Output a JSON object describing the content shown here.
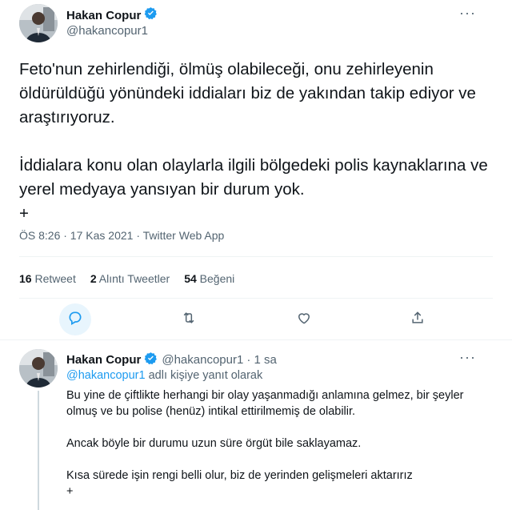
{
  "main_tweet": {
    "author_name": "Hakan Copur",
    "author_handle": "@hakancopur1",
    "more_label": "···",
    "text": "Feto'nun zehirlendiği, ölmüş olabileceği, onu zehirleyenin öldürüldüğü yönündeki iddiaları biz de yakından takip ediyor ve araştırıyoruz.\n\nİddialara konu olan olaylarla ilgili bölgedeki polis kaynaklarına ve yerel medyaya yansıyan bir durum yok.\n+",
    "timestamp": "ÖS 8:26 · 17 Kas 2021 · Twitter Web App",
    "stats": {
      "retweets_count": "16",
      "retweets_label": "Retweet",
      "quotes_count": "2",
      "quotes_label": "Alıntı Tweetler",
      "likes_count": "54",
      "likes_label": "Beğeni"
    },
    "actions": [
      "reply-icon",
      "retweet-icon",
      "like-icon",
      "share-icon"
    ]
  },
  "reply_tweet": {
    "author_name": "Hakan Copur",
    "author_handle": "@hakancopur1",
    "time": "· 1 sa",
    "more_label": "···",
    "reply_to_handle": "@hakancopur1",
    "reply_to_suffix": " adlı kişiye yanıt olarak",
    "text": "Bu yine de çiftlikte herhangi bir olay yaşanmadığı anlamına gelmez, bir şeyler olmuş ve bu polise (henüz) intikal ettirilmemiş de olabilir.\n\nAncak böyle bir durumu uzun süre örgüt bile saklayamaz.\n\nKısa sürede işin rengi belli olur, biz de yerinden gelişmeleri aktarırız\n+"
  },
  "colors": {
    "accent": "#1d9bf0",
    "muted": "#536471",
    "text": "#0f1419",
    "divider": "#eff3f4"
  }
}
